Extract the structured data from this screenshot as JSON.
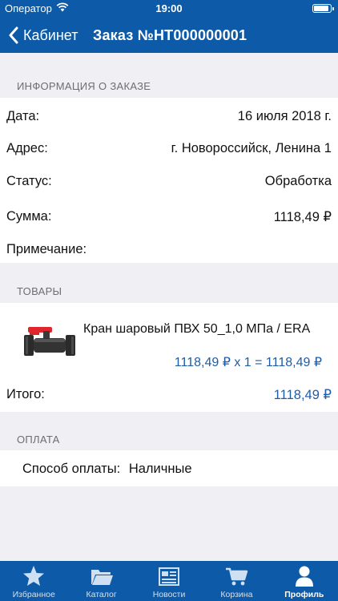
{
  "status_bar": {
    "carrier": "Оператор",
    "time": "19:00"
  },
  "nav": {
    "back_label": "Кабинет",
    "title": "Заказ №НТ000000001"
  },
  "order_info": {
    "header": "ИНФОРМАЦИЯ О ЗАКАЗЕ",
    "rows": [
      {
        "label": "Дата:",
        "value": "16 июля 2018 г."
      },
      {
        "label": "Адрес:",
        "value": "г. Новороссийск, Ленина 1"
      },
      {
        "label": "Статус:",
        "value": "Обработка"
      },
      {
        "label": "Сумма:",
        "value": "1118,49 ₽"
      },
      {
        "label": "Примечание:",
        "value": ""
      }
    ]
  },
  "goods": {
    "header": "ТОВАРЫ",
    "items": [
      {
        "name": "Кран шаровый ПВХ 50_1,0 МПа / ERA",
        "calc": "1118,49 ₽ х 1 = 1118,49 ₽"
      }
    ],
    "total_label": "Итого:",
    "total_value": "1118,49 ₽"
  },
  "payment": {
    "header": "ОПЛАТА",
    "method_label": "Способ оплаты:",
    "method_value": "Наличные"
  },
  "tabs": [
    {
      "label": "Избранное",
      "icon": "star-icon",
      "active": false
    },
    {
      "label": "Каталог",
      "icon": "folder-icon",
      "active": false
    },
    {
      "label": "Новости",
      "icon": "newspaper-icon",
      "active": false
    },
    {
      "label": "Корзина",
      "icon": "cart-icon",
      "active": false
    },
    {
      "label": "Профиль",
      "icon": "user-icon",
      "active": true
    }
  ],
  "colors": {
    "nav": "#0d5ba8",
    "accent": "#1e5ca8",
    "background": "#efeff4"
  }
}
